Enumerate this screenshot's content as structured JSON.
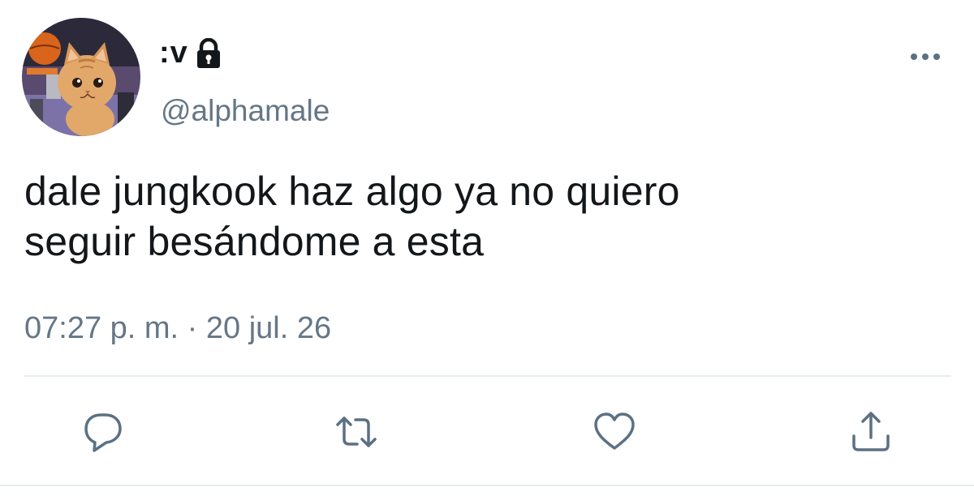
{
  "user": {
    "display_name": ":v",
    "handle": "@alphamale",
    "protected": true
  },
  "tweet": {
    "text_line_1": "dale jungkook haz algo ya no quiero",
    "text_line_2": "seguir besándome a esta",
    "timestamp": "07:27 p. m. · 20 jul. 26"
  },
  "actions": {
    "reply": "reply-icon",
    "retweet": "retweet-icon",
    "like": "heart-icon",
    "share": "share-icon"
  },
  "colors": {
    "text_primary": "#14171a",
    "text_secondary": "#657786",
    "icon": "#5b7083",
    "divider": "#e6ecf0"
  }
}
